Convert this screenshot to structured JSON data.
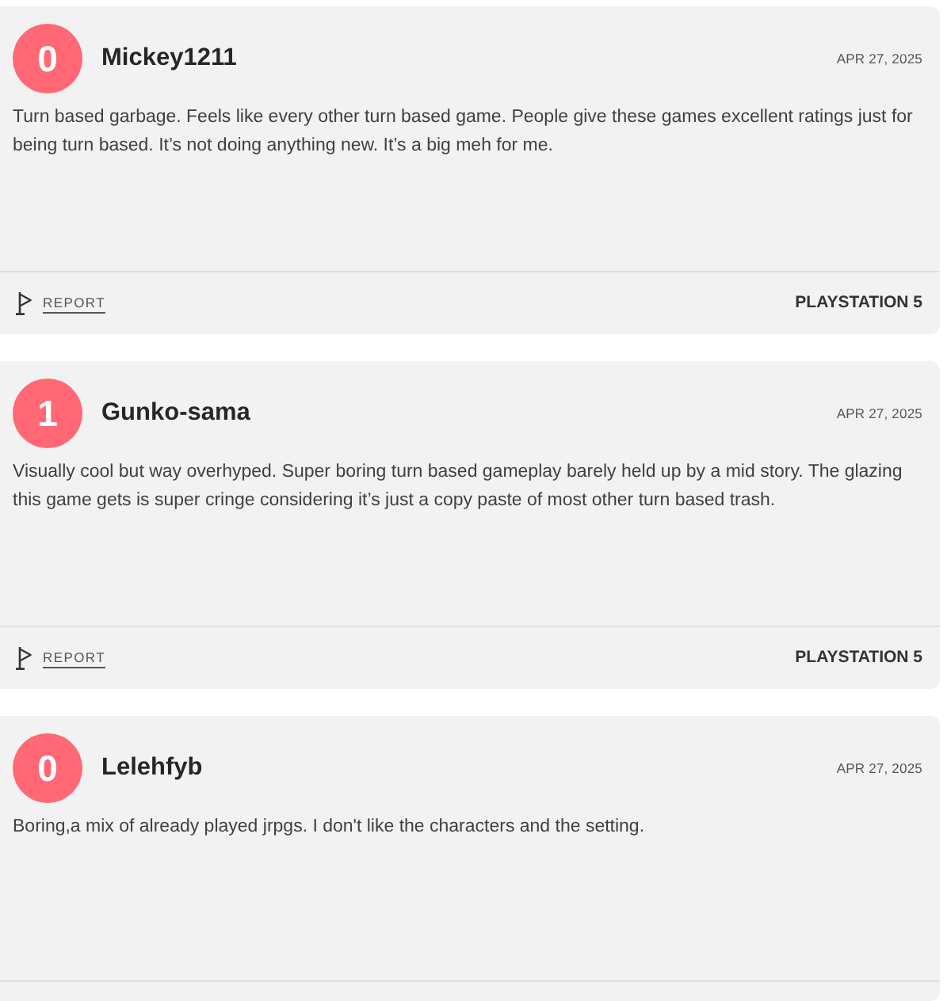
{
  "reviews": [
    {
      "score": "0",
      "username": "Mickey1211",
      "date": "APR 27, 2025",
      "text": "Turn based garbage. Feels like every other turn based game. People give these games excellent ratings just for being turn based. It’s not doing anything new. It’s a big meh for me.",
      "report": "REPORT",
      "platform": "PLAYSTATION 5"
    },
    {
      "score": "1",
      "username": "Gunko-sama",
      "date": "APR 27, 2025",
      "text": "Visually cool but way overhyped. Super boring turn based gameplay barely held up by a mid story. The glazing this game gets is super cringe considering it’s just a copy paste of most other turn based trash.",
      "report": "REPORT",
      "platform": "PLAYSTATION 5"
    },
    {
      "score": "0",
      "username": "Lelehfyb",
      "date": "APR 27, 2025",
      "text": "Boring,a mix of already played jrpgs. I don't like the characters and the setting."
    }
  ]
}
